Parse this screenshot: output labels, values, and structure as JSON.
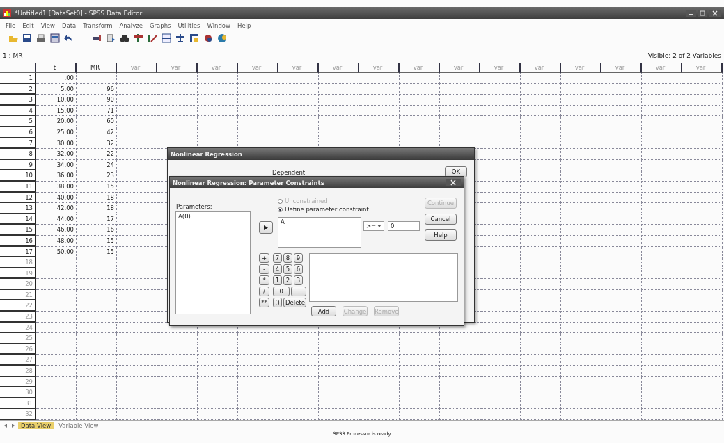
{
  "window": {
    "title": "*Untitled1 [DataSet0] - SPSS Data Editor"
  },
  "menu": [
    "File",
    "Edit",
    "View",
    "Data",
    "Transform",
    "Analyze",
    "Graphs",
    "Utilities",
    "Window",
    "Help"
  ],
  "cell_ref": "1 : MR",
  "visible_info": "Visible: 2 of 2 Variables",
  "grid": {
    "columns": [
      "t",
      "MR",
      "var",
      "var",
      "var",
      "var",
      "var",
      "var",
      "var",
      "var",
      "var",
      "var",
      "var",
      "var",
      "var",
      "var",
      "var"
    ],
    "rows": [
      {
        "label": "1",
        "cells": [
          ".00",
          "."
        ]
      },
      {
        "label": "2",
        "cells": [
          "5.00",
          "96"
        ]
      },
      {
        "label": "3",
        "cells": [
          "10.00",
          "90"
        ]
      },
      {
        "label": "4",
        "cells": [
          "15.00",
          "71"
        ]
      },
      {
        "label": "5",
        "cells": [
          "20.00",
          "60"
        ]
      },
      {
        "label": "6",
        "cells": [
          "25.00",
          "42"
        ]
      },
      {
        "label": "7",
        "cells": [
          "30.00",
          "32"
        ]
      },
      {
        "label": "8",
        "cells": [
          "32.00",
          "22"
        ]
      },
      {
        "label": "9",
        "cells": [
          "34.00",
          "24"
        ]
      },
      {
        "label": "10",
        "cells": [
          "36.00",
          "23"
        ]
      },
      {
        "label": "11",
        "cells": [
          "38.00",
          "15"
        ]
      },
      {
        "label": "12",
        "cells": [
          "40.00",
          "18"
        ]
      },
      {
        "label": "13",
        "cells": [
          "42.00",
          "18"
        ]
      },
      {
        "label": "14",
        "cells": [
          "44.00",
          "17"
        ]
      },
      {
        "label": "15",
        "cells": [
          "46.00",
          "16"
        ]
      },
      {
        "label": "16",
        "cells": [
          "48.00",
          "15"
        ]
      },
      {
        "label": "17",
        "cells": [
          "50.00",
          "15"
        ]
      },
      {
        "label": "18"
      },
      {
        "label": "19"
      },
      {
        "label": "20"
      },
      {
        "label": "21"
      },
      {
        "label": "22"
      },
      {
        "label": "23"
      },
      {
        "label": "24"
      },
      {
        "label": "25"
      },
      {
        "label": "26"
      },
      {
        "label": "27"
      },
      {
        "label": "28"
      },
      {
        "label": "29"
      },
      {
        "label": "30"
      },
      {
        "label": "31"
      },
      {
        "label": "32"
      }
    ]
  },
  "tabs": [
    {
      "label": "Data View",
      "selected": true
    },
    {
      "label": "Variable View",
      "selected": false
    }
  ],
  "status_bar": "SPSS Processor is ready",
  "back_dialog": {
    "title": "Nonlinear Regression",
    "dependent_label": "Dependent",
    "buttons": [
      "OK"
    ]
  },
  "constraints_dialog": {
    "title": "Nonlinear Regression: Parameter Constraints",
    "parameters_label": "Parameters:",
    "parameters": [
      "A(0)"
    ],
    "radios": [
      {
        "label": "Unconstrained",
        "selected": false,
        "disabled": true
      },
      {
        "label": "Define parameter constraint",
        "selected": true,
        "disabled": false
      }
    ],
    "expression": "A",
    "operator": ">=",
    "value": "0",
    "buttons": [
      {
        "label": "Continue",
        "disabled": true
      },
      {
        "label": "Cancel",
        "disabled": false
      },
      {
        "label": "Help",
        "disabled": false
      }
    ],
    "keypad": [
      [
        "+",
        "7",
        "8",
        "9"
      ],
      [
        "-",
        "4",
        "5",
        "6"
      ],
      [
        "*",
        "1",
        "2",
        "3"
      ],
      [
        "/",
        "0",
        "."
      ],
      [
        "**",
        "()",
        "Delete"
      ]
    ],
    "list_buttons": [
      {
        "label": "Add",
        "disabled": false
      },
      {
        "label": "Change",
        "disabled": true
      },
      {
        "label": "Remove",
        "disabled": true
      }
    ]
  }
}
